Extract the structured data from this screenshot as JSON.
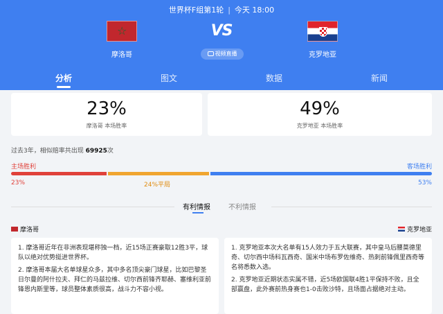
{
  "header": {
    "competition": "世界杯F组第1轮",
    "time": "今天 18:00",
    "vs": "VS",
    "live_label": "视频直播",
    "home": {
      "name": "摩洛哥",
      "flag": "morocco-flag"
    },
    "away": {
      "name": "克罗地亚",
      "flag": "croatia-flag"
    },
    "tabs": [
      "分析",
      "图文",
      "数据",
      "新闻"
    ],
    "active_tab": "分析",
    "color": "#3f7ff0"
  },
  "win_rate": {
    "home": {
      "pct": "23%",
      "desc": "摩洛哥 本场胜率"
    },
    "away": {
      "pct": "49%",
      "desc": "克罗地亚 本场胜率"
    }
  },
  "history": {
    "prefix": "过去3年，相似赔率共出现",
    "count": "69925",
    "suffix": "次"
  },
  "outcome": {
    "home_label": "主场胜利",
    "away_label": "客场胜利",
    "home_pct": "23%",
    "draw_pct": "24%平局",
    "away_pct": "53%",
    "colors": {
      "home": "#e0413a",
      "draw": "#f0a530",
      "away": "#3f7ff0"
    }
  },
  "intel": {
    "tabs": [
      "有利情报",
      "不利情报"
    ],
    "active_tab": "有利情报",
    "home": {
      "team": "摩洛哥",
      "items": [
        "1. 摩洛哥近年在非洲表现堪称独一档，近15场正赛豪取12胜3平，球队以绝对优势挺进世界杯。",
        "2. 摩洛哥本届大名单球星众多，其中多名顶尖豪门球星，比如巴黎圣日尔曼的阿什拉夫、拜仁的马兹拉维、切尔西前锋齐耶赫、塞维利亚前锋恩内斯里等，球员整体素质很高，战斗力不容小视。"
      ]
    },
    "away": {
      "team": "克罗地亚",
      "items": [
        "1. 克罗地亚本次大名单有15人效力于五大联赛，其中皇马后腰莫德里奇、切尔西中场科瓦西奇、国米中场布罗佐维奇、热刺前锋佩里西奇等名将悉数入选。",
        "2. 克罗地亚近期状态实属不错，近5场欧国联4胜1平保持不败，且全部赢盘，此外赛前热身赛也1-0击败沙特，且场面占据绝对主动。"
      ]
    }
  }
}
